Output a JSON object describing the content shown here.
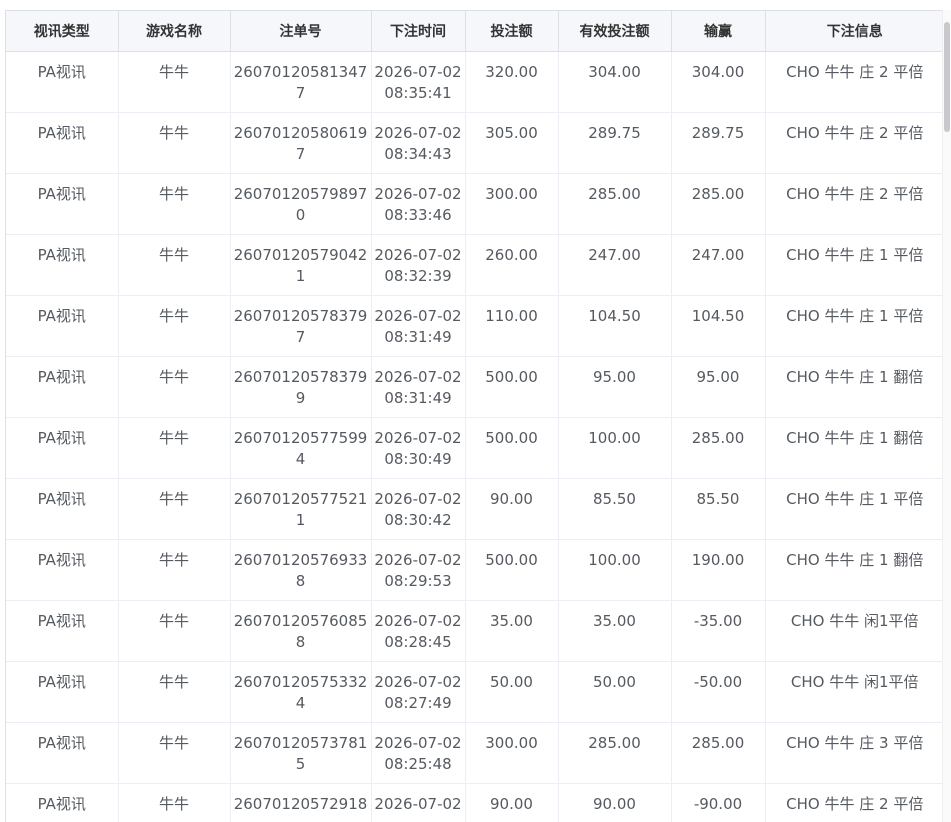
{
  "table": {
    "headers": [
      "视讯类型",
      "游戏名称",
      "注单号",
      "下注时间",
      "投注额",
      "有效投注额",
      "输赢",
      "下注信息"
    ],
    "rows": [
      [
        "PA视讯",
        "牛牛",
        "260701205813477",
        "2026-07-02 08:35:41",
        "320.00",
        "304.00",
        "304.00",
        "CHO 牛牛 庄 2 平倍"
      ],
      [
        "PA视讯",
        "牛牛",
        "260701205806197",
        "2026-07-02 08:34:43",
        "305.00",
        "289.75",
        "289.75",
        "CHO 牛牛 庄 2 平倍"
      ],
      [
        "PA视讯",
        "牛牛",
        "260701205798970",
        "2026-07-02 08:33:46",
        "300.00",
        "285.00",
        "285.00",
        "CHO 牛牛 庄 2 平倍"
      ],
      [
        "PA视讯",
        "牛牛",
        "260701205790421",
        "2026-07-02 08:32:39",
        "260.00",
        "247.00",
        "247.00",
        "CHO 牛牛 庄 1 平倍"
      ],
      [
        "PA视讯",
        "牛牛",
        "260701205783797",
        "2026-07-02 08:31:49",
        "110.00",
        "104.50",
        "104.50",
        "CHO 牛牛 庄 1 平倍"
      ],
      [
        "PA视讯",
        "牛牛",
        "260701205783799",
        "2026-07-02 08:31:49",
        "500.00",
        "95.00",
        "95.00",
        "CHO 牛牛 庄 1 翻倍"
      ],
      [
        "PA视讯",
        "牛牛",
        "260701205775994",
        "2026-07-02 08:30:49",
        "500.00",
        "100.00",
        "285.00",
        "CHO 牛牛 庄 1 翻倍"
      ],
      [
        "PA视讯",
        "牛牛",
        "260701205775211",
        "2026-07-02 08:30:42",
        "90.00",
        "85.50",
        "85.50",
        "CHO 牛牛 庄 1 平倍"
      ],
      [
        "PA视讯",
        "牛牛",
        "260701205769338",
        "2026-07-02 08:29:53",
        "500.00",
        "100.00",
        "190.00",
        "CHO 牛牛 庄 1 翻倍"
      ],
      [
        "PA视讯",
        "牛牛",
        "260701205760858",
        "2026-07-02 08:28:45",
        "35.00",
        "35.00",
        "-35.00",
        "CHO 牛牛 闲1平倍"
      ],
      [
        "PA视讯",
        "牛牛",
        "260701205753324",
        "2026-07-02 08:27:49",
        "50.00",
        "50.00",
        "-50.00",
        "CHO 牛牛 闲1平倍"
      ],
      [
        "PA视讯",
        "牛牛",
        "260701205737815",
        "2026-07-02 08:25:48",
        "300.00",
        "285.00",
        "285.00",
        "CHO 牛牛 庄 3 平倍"
      ],
      [
        "PA视讯",
        "牛牛",
        "26070120572918",
        "2026-07-02",
        "90.00",
        "90.00",
        "-90.00",
        "CHO 牛牛 庄 2 平倍"
      ]
    ]
  }
}
